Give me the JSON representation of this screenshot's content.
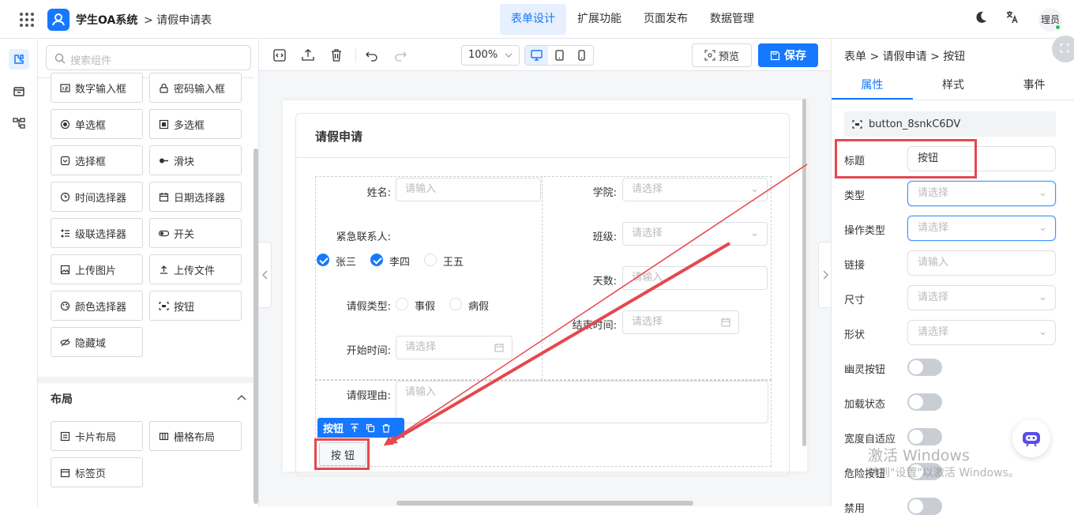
{
  "app": {
    "title": "学生OA系统",
    "breadcrumb": "> 请假申请表"
  },
  "top_nav": [
    {
      "label": "表单设计",
      "active": true
    },
    {
      "label": "扩展功能"
    },
    {
      "label": "页面发布"
    },
    {
      "label": "数据管理"
    }
  ],
  "user": {
    "avatar_text": "理员"
  },
  "components": {
    "search_placeholder": "搜索组件",
    "items": [
      "数字输入框",
      "密码输入框",
      "单选框",
      "多选框",
      "选择框",
      "滑块",
      "时间选择器",
      "日期选择器",
      "级联选择器",
      "开关",
      "上传图片",
      "上传文件",
      "颜色选择器",
      "按钮",
      "隐藏域"
    ],
    "layout_section": "布局",
    "layout_items": [
      "卡片布局",
      "栅格布局",
      "标签页"
    ]
  },
  "toolbar": {
    "zoom": "100%",
    "preview": "预览",
    "save": "保存"
  },
  "form": {
    "title": "请假申请",
    "name_label": "姓名:",
    "name_placeholder": "请输入",
    "college_label": "学院:",
    "college_placeholder": "请选择",
    "contact_label": "紧急联系人:",
    "contacts": [
      {
        "label": "张三",
        "checked": true
      },
      {
        "label": "李四",
        "checked": true
      },
      {
        "label": "王五",
        "checked": false
      }
    ],
    "class_label": "班级:",
    "class_placeholder": "请选择",
    "days_label": "天数:",
    "days_placeholder": "请输入",
    "type_label": "请假类型:",
    "types": [
      "事假",
      "病假"
    ],
    "end_label": "结束时间:",
    "end_placeholder": "请选择",
    "start_label": "开始时间:",
    "start_placeholder": "请选择",
    "reason_label": "请假理由:",
    "reason_placeholder": "请输入",
    "selected_tag": "按钮",
    "button_text": "按 钮"
  },
  "props": {
    "breadcrumb": "表单 > 请假申请 > 按钮",
    "tabs": [
      "属性",
      "样式",
      "事件"
    ],
    "component_id": "button_8snkC6DV",
    "fields": [
      {
        "label": "标题",
        "value": "按钮"
      },
      {
        "label": "类型",
        "placeholder": "请选择"
      },
      {
        "label": "操作类型",
        "placeholder": "请选择"
      },
      {
        "label": "链接",
        "placeholder": "请输入"
      },
      {
        "label": "尺寸",
        "placeholder": "请选择"
      },
      {
        "label": "形状",
        "placeholder": "请选择"
      }
    ],
    "toggles": [
      "幽灵按钮",
      "加载状态",
      "宽度自适应",
      "危险按钮",
      "禁用"
    ]
  },
  "watermark": {
    "line1": "激活 Windows",
    "line2": "转到\"设置\"以激活 Windows。"
  },
  "colors": {
    "accent": "#1677ff",
    "highlight": "#e5484d"
  }
}
